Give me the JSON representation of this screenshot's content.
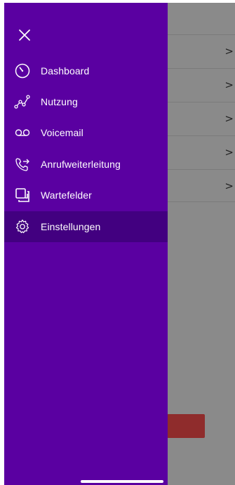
{
  "drawer": {
    "background": "#5a00a1",
    "active_background": "#420080",
    "close_icon": "close-icon",
    "items": [
      {
        "label": "Dashboard",
        "icon": "dashboard-gauge-icon",
        "active": false
      },
      {
        "label": "Nutzung",
        "icon": "usage-graph-icon",
        "active": false
      },
      {
        "label": "Voicemail",
        "icon": "voicemail-icon",
        "active": false
      },
      {
        "label": "Anrufweiterleitung",
        "icon": "call-forwarding-icon",
        "active": false
      },
      {
        "label": "Wartefelder",
        "icon": "queue-icon",
        "active": false
      },
      {
        "label": "Einstellungen",
        "icon": "gear-icon",
        "active": true
      }
    ]
  },
  "underlay": {
    "chevron": ">",
    "rows": 5,
    "button_color": "#8f2c2c"
  }
}
